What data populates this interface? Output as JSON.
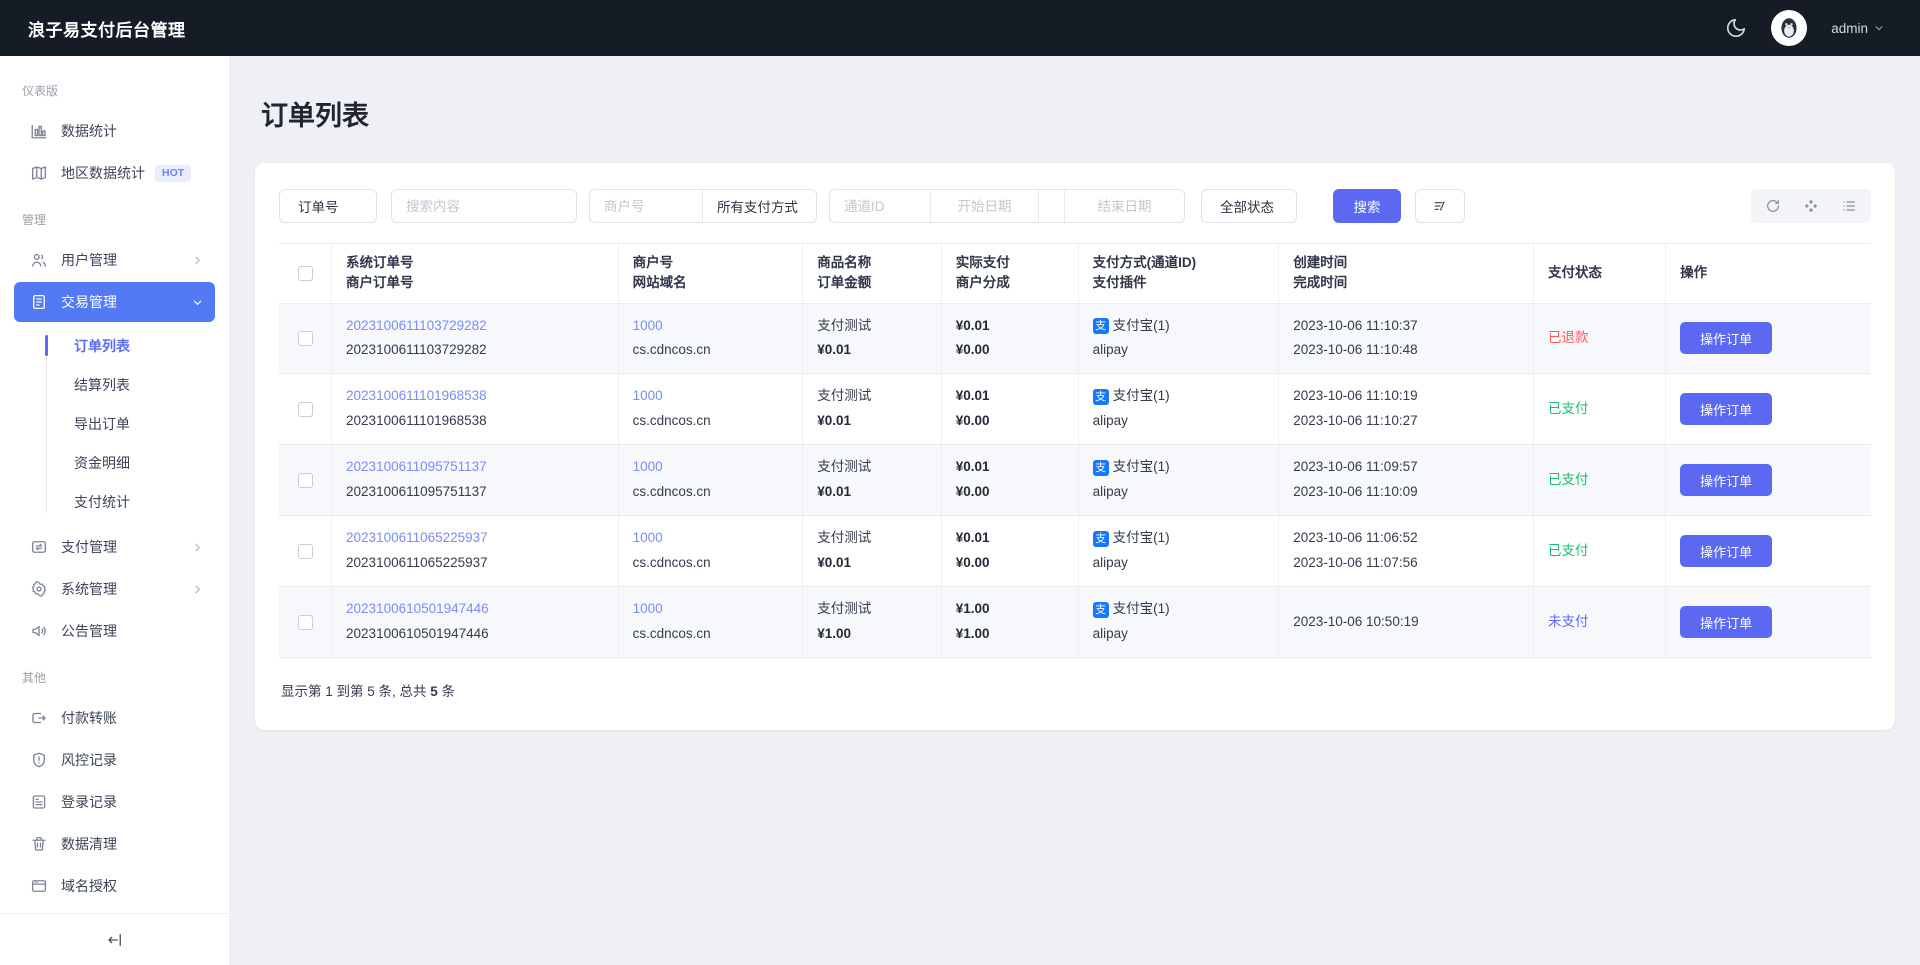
{
  "topbar": {
    "title": "浪子易支付后台管理",
    "username": "admin"
  },
  "sidebar": {
    "sections": [
      {
        "label": "仪表版",
        "items": [
          {
            "label": "数据统计"
          },
          {
            "label": "地区数据统计",
            "badge": "HOT"
          }
        ]
      },
      {
        "label": "管理",
        "items": [
          {
            "label": "用户管理"
          },
          {
            "label": "交易管理"
          },
          {
            "label": "支付管理"
          },
          {
            "label": "系统管理"
          },
          {
            "label": "公告管理"
          }
        ]
      },
      {
        "label": "其他",
        "items": [
          {
            "label": "付款转账"
          },
          {
            "label": "风控记录"
          },
          {
            "label": "登录记录"
          },
          {
            "label": "数据清理"
          },
          {
            "label": "域名授权"
          }
        ]
      }
    ],
    "submenu": [
      "订单列表",
      "结算列表",
      "导出订单",
      "资金明细",
      "支付统计"
    ]
  },
  "page": {
    "title": "订单列表"
  },
  "filters": {
    "order_type": "订单号",
    "search_placeholder": "搜索内容",
    "merchant_placeholder": "商户号",
    "pay_method": "所有支付方式",
    "channel_placeholder": "通道ID",
    "start_date_placeholder": "开始日期",
    "end_date_placeholder": "结束日期",
    "status": "全部状态",
    "search_button": "搜索"
  },
  "table": {
    "headers": [
      [
        "系统订单号",
        "商户订单号"
      ],
      [
        "商户号",
        "网站域名"
      ],
      [
        "商品名称",
        "订单金额"
      ],
      [
        "实际支付",
        "商户分成"
      ],
      [
        "支付方式(通道ID)",
        "支付插件"
      ],
      [
        "创建时间",
        "完成时间"
      ],
      [
        "支付状态"
      ],
      [
        "操作"
      ]
    ],
    "alipay_glyph": "支",
    "action_label": "操作订单",
    "rows": [
      {
        "sys_order": "2023100611103729282",
        "merch_order": "2023100611103729282",
        "merchant_id": "1000",
        "domain": "cs.cdncos.cn",
        "product": "支付测试",
        "amount": "¥0.01",
        "paid": "¥0.01",
        "share": "¥0.00",
        "method": "支付宝(1)",
        "plugin": "alipay",
        "created": "2023-10-06 11:10:37",
        "completed": "2023-10-06 11:10:48",
        "status": "已退款"
      },
      {
        "sys_order": "2023100611101968538",
        "merch_order": "2023100611101968538",
        "merchant_id": "1000",
        "domain": "cs.cdncos.cn",
        "product": "支付测试",
        "amount": "¥0.01",
        "paid": "¥0.01",
        "share": "¥0.00",
        "method": "支付宝(1)",
        "plugin": "alipay",
        "created": "2023-10-06 11:10:19",
        "completed": "2023-10-06 11:10:27",
        "status": "已支付"
      },
      {
        "sys_order": "2023100611095751137",
        "merch_order": "2023100611095751137",
        "merchant_id": "1000",
        "domain": "cs.cdncos.cn",
        "product": "支付测试",
        "amount": "¥0.01",
        "paid": "¥0.01",
        "share": "¥0.00",
        "method": "支付宝(1)",
        "plugin": "alipay",
        "created": "2023-10-06 11:09:57",
        "completed": "2023-10-06 11:10:09",
        "status": "已支付"
      },
      {
        "sys_order": "2023100611065225937",
        "merch_order": "2023100611065225937",
        "merchant_id": "1000",
        "domain": "cs.cdncos.cn",
        "product": "支付测试",
        "amount": "¥0.01",
        "paid": "¥0.01",
        "share": "¥0.00",
        "method": "支付宝(1)",
        "plugin": "alipay",
        "created": "2023-10-06 11:06:52",
        "completed": "2023-10-06 11:07:56",
        "status": "已支付"
      },
      {
        "sys_order": "2023100610501947446",
        "merch_order": "2023100610501947446",
        "merchant_id": "1000",
        "domain": "cs.cdncos.cn",
        "product": "支付测试",
        "amount": "¥1.00",
        "paid": "¥1.00",
        "share": "¥1.00",
        "method": "支付宝(1)",
        "plugin": "alipay",
        "created": "2023-10-06 10:50:19",
        "completed": "",
        "status": "未支付"
      }
    ]
  },
  "footer": {
    "prefix": "显示第 1 到第 5 条, 总共 ",
    "total": "5",
    "suffix": " 条"
  },
  "colors": {
    "accent": "#5a68f2",
    "sidebar_active": "#5379f5",
    "link": "#7b8bf8",
    "status_refunded": "#f25e5e",
    "status_paid": "#1cbe6e",
    "status_unpaid": "#5a6cf3",
    "alipay_blue": "#1677ff",
    "topbar_bg": "#151c26"
  }
}
